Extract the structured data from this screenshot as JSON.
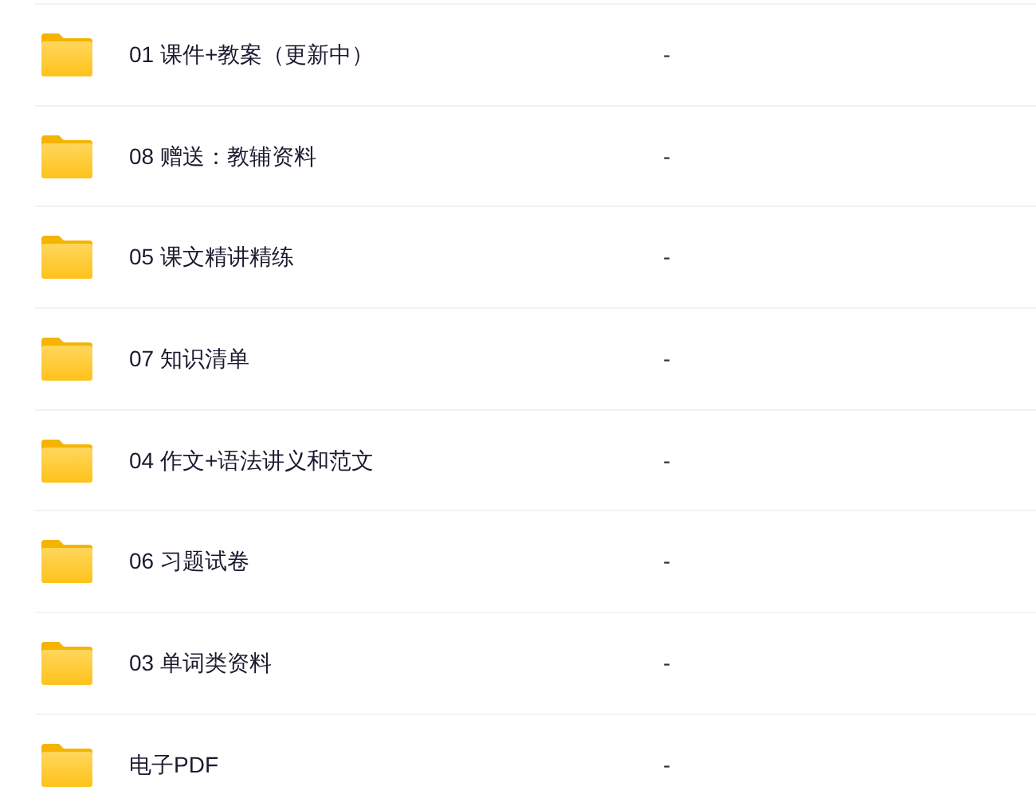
{
  "files": [
    {
      "name": "01 课件+教案（更新中）",
      "size": "-"
    },
    {
      "name": "08 赠送：教辅资料",
      "size": "-"
    },
    {
      "name": "05 课文精讲精练",
      "size": "-"
    },
    {
      "name": "07 知识清单",
      "size": "-"
    },
    {
      "name": "04 作文+语法讲义和范文",
      "size": "-"
    },
    {
      "name": "06 习题试卷",
      "size": "-"
    },
    {
      "name": "03 单词类资料",
      "size": "-"
    },
    {
      "name": "电子PDF",
      "size": "-"
    }
  ]
}
